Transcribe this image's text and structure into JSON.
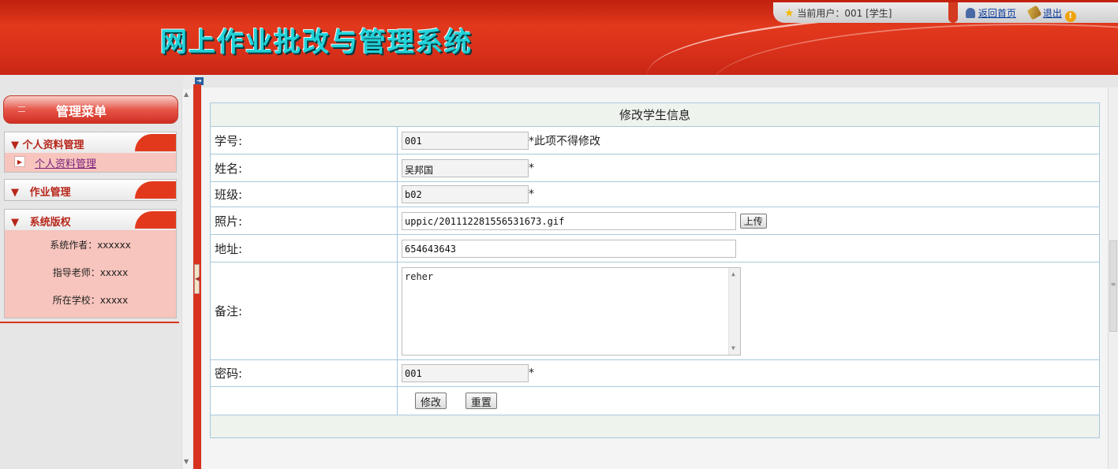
{
  "header": {
    "title": "网上作业批改与管理系统",
    "current_user_label": "当前用户：001 [学生]",
    "home_link": "返回首页",
    "logout_link": "退出"
  },
  "sidebar": {
    "menu_title": "管理菜单",
    "sections": [
      {
        "label": "个人资料管理",
        "items": [
          {
            "label": "个人资料管理"
          }
        ]
      },
      {
        "label": "作业管理",
        "items": []
      },
      {
        "label": "系统版权",
        "info": [
          "系统作者：xxxxxx",
          "指导老师：xxxxx",
          "所在学校：xxxxx"
        ]
      }
    ]
  },
  "form": {
    "caption": "修改学生信息",
    "fields": {
      "student_id": {
        "label": "学号:",
        "value": "001",
        "note": "*此项不得修改"
      },
      "name": {
        "label": "姓名:",
        "value": "吴邦国",
        "note": "*"
      },
      "class": {
        "label": "班级:",
        "value": "b02",
        "note": "*"
      },
      "photo": {
        "label": "照片:",
        "value": "uppic/201112281556531673.gif",
        "button": "上传"
      },
      "address": {
        "label": "地址:",
        "value": "654643643"
      },
      "remark": {
        "label": "备注:",
        "value": "reher"
      },
      "password": {
        "label": "密码:",
        "value": "001",
        "note": "*"
      }
    },
    "buttons": {
      "submit": "修改",
      "reset": "重置"
    }
  },
  "icons": {
    "star": "star-icon",
    "user": "user-icon",
    "home_tool": "wrench-icon",
    "exit": "exit-icon"
  },
  "colors": {
    "header_red": "#e2391d",
    "title_cyan": "#21d2d8",
    "table_border": "#a9c8dc"
  }
}
